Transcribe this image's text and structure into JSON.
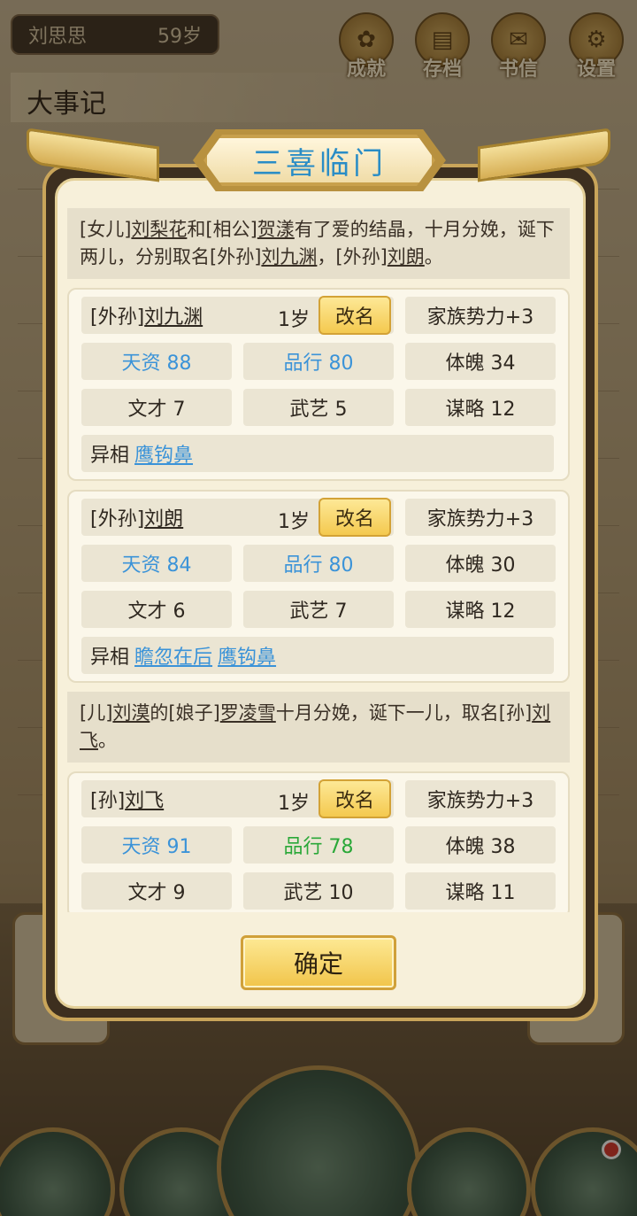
{
  "background": {
    "character_name": "刘思思",
    "character_age": "59岁",
    "menu": [
      {
        "label": "成就",
        "icon": "achievement-icon"
      },
      {
        "label": "存档",
        "icon": "save-icon"
      },
      {
        "label": "书信",
        "icon": "letter-icon"
      },
      {
        "label": "设置",
        "icon": "settings-icon"
      }
    ],
    "events_title": "大事记"
  },
  "dialog": {
    "title": "三喜临门",
    "confirm_label": "确定",
    "notices": [
      {
        "parts": [
          "[女儿]",
          "刘梨花",
          "和[相公]",
          "贺漾",
          "有了爱的结晶，十月分娩，诞下两儿，分别取名[外孙]",
          "刘九渊",
          "，[外孙]",
          "刘朗",
          "。"
        ]
      },
      {
        "parts": [
          "[儿]",
          "刘漠",
          "的[娘子]",
          "罗凌雪",
          "十月分娩，诞下一儿，取名[孙]",
          "刘飞",
          "。"
        ]
      }
    ],
    "children": [
      {
        "relation": "[外孙]",
        "name": "刘九渊",
        "age": "1岁",
        "rename": "改名",
        "influence": "家族势力+3",
        "talent": "天资 88",
        "morality": "品行 80",
        "physique": "体魄 34",
        "literary": "文才 7",
        "martial": "武艺 5",
        "strategy": "谋略 12",
        "trait_label": "异相",
        "traits": [
          "鹰钩鼻"
        ]
      },
      {
        "relation": "[外孙]",
        "name": "刘朗",
        "age": "1岁",
        "rename": "改名",
        "influence": "家族势力+3",
        "talent": "天资 84",
        "morality": "品行 80",
        "physique": "体魄 30",
        "literary": "文才 6",
        "martial": "武艺 7",
        "strategy": "谋略 12",
        "trait_label": "异相",
        "traits": [
          "瞻忽在后",
          "鹰钩鼻"
        ]
      },
      {
        "relation": "[孙]",
        "name": "刘飞",
        "age": "1岁",
        "rename": "改名",
        "influence": "家族势力+3",
        "talent": "天资 91",
        "morality": "品行 78",
        "physique": "体魄 38",
        "literary": "文才 9",
        "martial": "武艺 10",
        "strategy": "谋略 11"
      }
    ]
  },
  "colors": {
    "blue_stat": "#3b93d8",
    "green_stat": "#2aa838",
    "title_blue": "#2a8dc6",
    "gold": "#f4c94f"
  }
}
